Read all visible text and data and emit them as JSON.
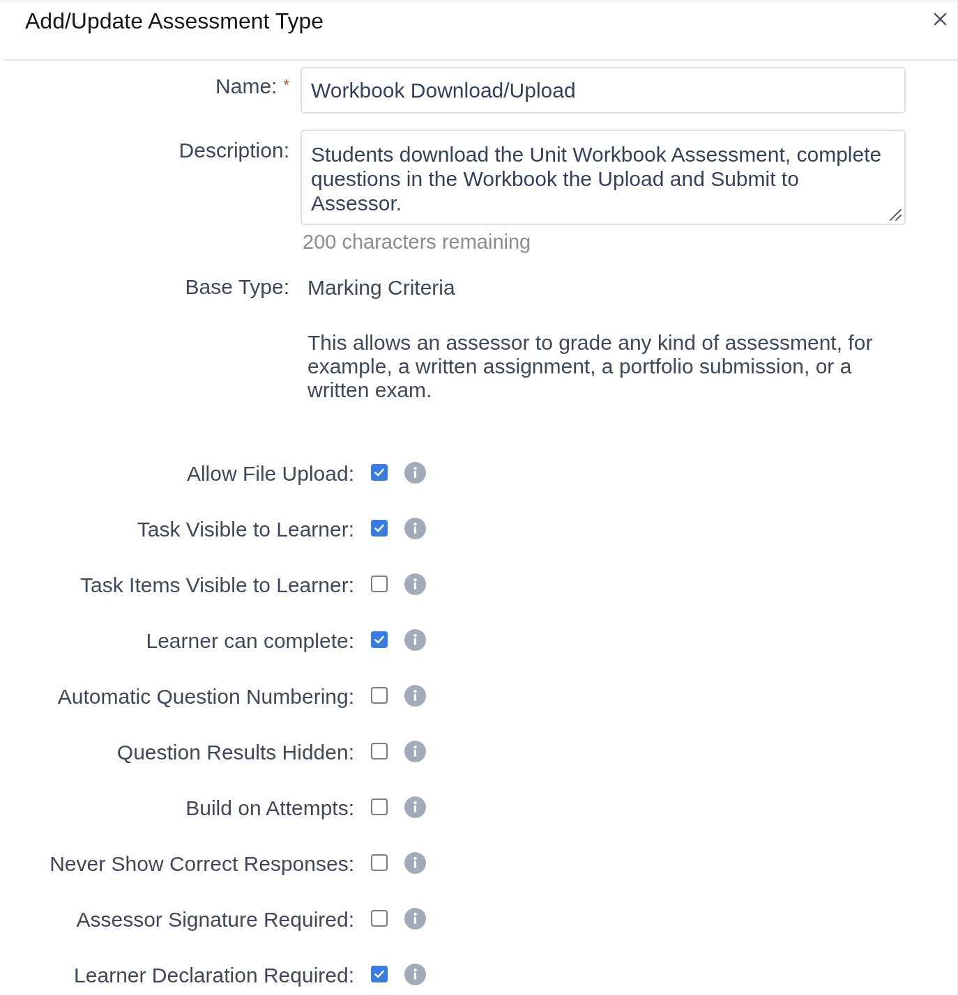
{
  "dialog": {
    "title": "Add/Update Assessment Type"
  },
  "form": {
    "name": {
      "label": "Name:",
      "required_marker": "*",
      "value": "Workbook Download/Upload"
    },
    "description": {
      "label": "Description:",
      "value": "Students download the Unit Workbook Assessment, complete questions in the Workbook the Upload and Submit to Assessor.",
      "helper": "200 characters remaining"
    },
    "base_type": {
      "label": "Base Type:",
      "value": "Marking Criteria",
      "explanation": "This allows an assessor to grade any kind of assessment, for example, a written assignment, a portfolio submission, or a written exam."
    }
  },
  "options": [
    {
      "label": "Allow File Upload:",
      "checked": true
    },
    {
      "label": "Task Visible to Learner:",
      "checked": true
    },
    {
      "label": "Task Items Visible to Learner:",
      "checked": false
    },
    {
      "label": "Learner can complete:",
      "checked": true
    },
    {
      "label": "Automatic Question Numbering:",
      "checked": false
    },
    {
      "label": "Question Results Hidden:",
      "checked": false
    },
    {
      "label": "Build on Attempts:",
      "checked": false
    },
    {
      "label": "Never Show Correct Responses:",
      "checked": false
    },
    {
      "label": "Assessor Signature Required:",
      "checked": false
    },
    {
      "label": "Learner Declaration Required:",
      "checked": true
    }
  ]
}
